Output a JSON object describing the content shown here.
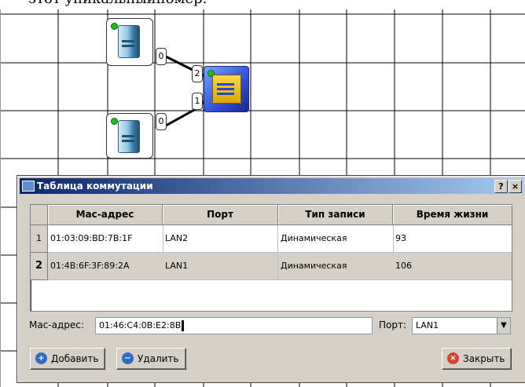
{
  "background_text": "этот уникальныйномер.",
  "network": {
    "nodes": [
      {
        "type": "computer",
        "icon": "server-icon"
      },
      {
        "type": "computer",
        "icon": "server-icon"
      },
      {
        "type": "switch",
        "icon": "switch-icon"
      }
    ],
    "ports": [
      "0",
      "0",
      "2",
      "1"
    ]
  },
  "dialog": {
    "title": "Таблица коммутации",
    "help_label": "?",
    "close_label": "×",
    "table": {
      "columns": [
        "Mac-адрес",
        "Порт",
        "Тип записи",
        "Время жизни"
      ],
      "rows": [
        {
          "index": "1",
          "mac": "01:03:09:BD:7B:1F",
          "port": "LAN2",
          "type": "Динамическая",
          "ttl": "93"
        },
        {
          "index": "2",
          "mac": "01:4B:6F:3F:89:2A",
          "port": "LAN1",
          "type": "Динамическая",
          "ttl": "106"
        }
      ]
    },
    "mac_label": "Mac-адрес:",
    "mac_value": "01:46:C4:0B:E2:8B",
    "port_label": "Порт:",
    "port_value": "LAN1",
    "buttons": {
      "add": "Добавить",
      "remove": "Удалить",
      "close": "Закрыть"
    },
    "colors": {
      "titlebar": "#0a246a",
      "add_icon": "#2e6cc7",
      "remove_icon": "#2e6cc7",
      "close_icon": "#d9432c"
    }
  }
}
